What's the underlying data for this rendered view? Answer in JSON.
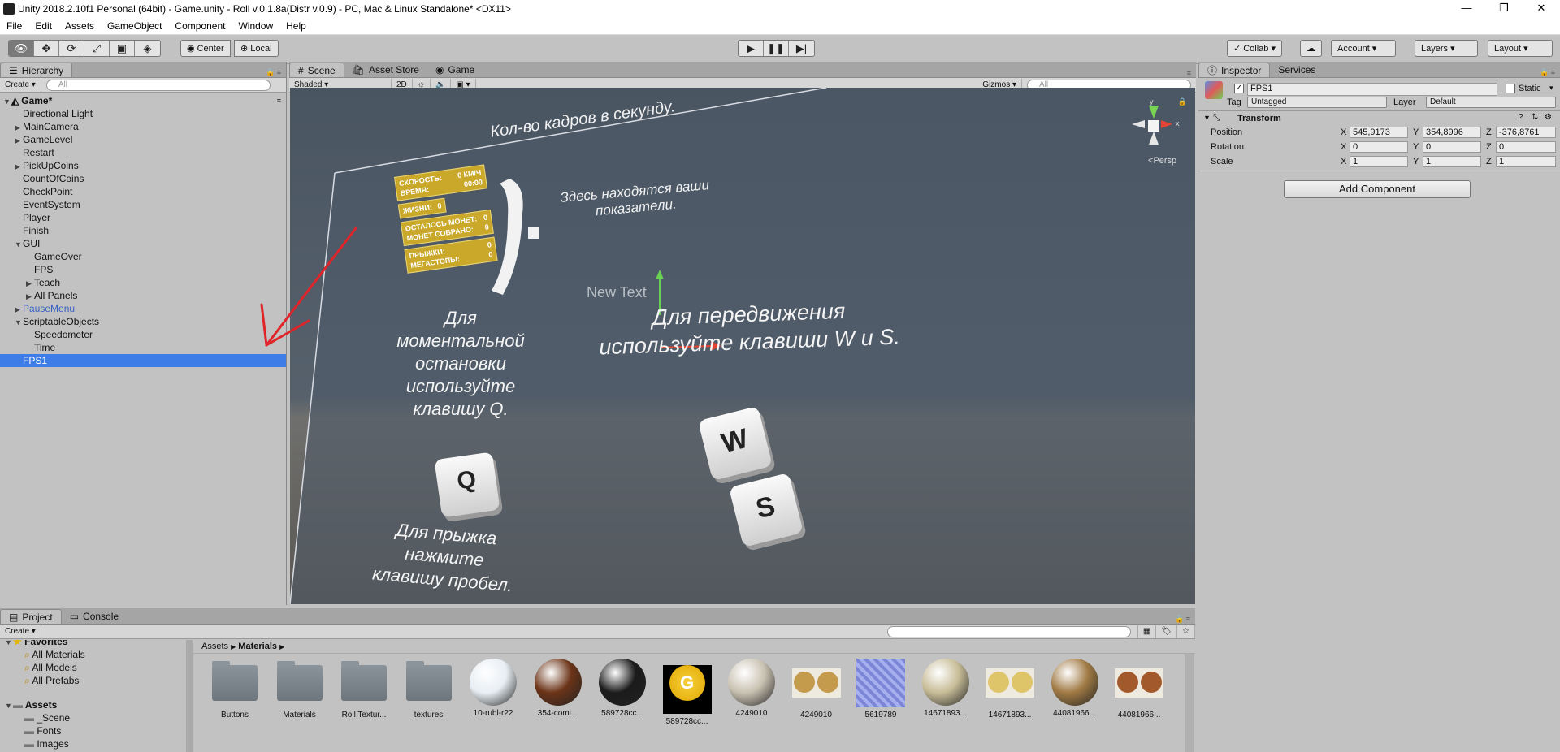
{
  "window": {
    "title": "Unity 2018.2.10f1 Personal (64bit) - Game.unity - Roll v.0.1.8a(Distr v.0.9) - PC, Mac & Linux Standalone* <DX11>",
    "minimize": "—",
    "maximize": "❐",
    "close": "✕"
  },
  "menu": [
    "File",
    "Edit",
    "Assets",
    "GameObject",
    "Component",
    "Window",
    "Help"
  ],
  "toolbar": {
    "tools": [
      "eye-icon",
      "move-icon",
      "rotate-icon",
      "scale-icon",
      "rect-icon",
      "transform-icon"
    ],
    "pivot": "Center",
    "space": "Local",
    "collab": "Collab ▾",
    "account": "Account ▾",
    "layers": "Layers ▾",
    "layout": "Layout ▾"
  },
  "hierarchy": {
    "tab": "Hierarchy",
    "create": "Create ▾",
    "search_placeholder": "All",
    "scene": "Game*",
    "items": [
      {
        "label": "Directional Light",
        "depth": 1,
        "arrow": ""
      },
      {
        "label": "MainCamera",
        "depth": 1,
        "arrow": "▶"
      },
      {
        "label": "GameLevel",
        "depth": 1,
        "arrow": "▶"
      },
      {
        "label": "Restart",
        "depth": 1,
        "arrow": ""
      },
      {
        "label": "PickUpCoins",
        "depth": 1,
        "arrow": "▶"
      },
      {
        "label": "CountOfCoins",
        "depth": 1,
        "arrow": ""
      },
      {
        "label": "CheckPoint",
        "depth": 1,
        "arrow": ""
      },
      {
        "label": "EventSystem",
        "depth": 1,
        "arrow": ""
      },
      {
        "label": "Player",
        "depth": 1,
        "arrow": ""
      },
      {
        "label": "Finish",
        "depth": 1,
        "arrow": ""
      },
      {
        "label": "GUI",
        "depth": 1,
        "arrow": "▼"
      },
      {
        "label": "GameOver",
        "depth": 2,
        "arrow": ""
      },
      {
        "label": "FPS",
        "depth": 2,
        "arrow": ""
      },
      {
        "label": "Teach",
        "depth": 2,
        "arrow": "▶"
      },
      {
        "label": "All Panels",
        "depth": 2,
        "arrow": "▶"
      },
      {
        "label": "PauseMenu",
        "depth": 1,
        "arrow": "▶",
        "prefab": true
      },
      {
        "label": "ScriptableObjects",
        "depth": 1,
        "arrow": "▼"
      },
      {
        "label": "Speedometer",
        "depth": 2,
        "arrow": ""
      },
      {
        "label": "Time",
        "depth": 2,
        "arrow": ""
      },
      {
        "label": "FPS1",
        "depth": 1,
        "arrow": "",
        "selected": true
      }
    ]
  },
  "sceneview": {
    "tabs": [
      "Scene",
      "Asset Store",
      "Game"
    ],
    "shading": "Shaded ▾",
    "mode2d": "2D",
    "gizmos": "Gizmos ▾",
    "search_placeholder": "All",
    "persp": "Persp",
    "texts": {
      "fps_header": "Кол-во кадров в секунду.",
      "hud_desc": "Здесь находятся ваши показатели.",
      "move": "Для передвижения используйте клавиши W и S.",
      "stop": "Для моментальной остановки используйте клавишу Q.",
      "jump": "Для прыжка нажмите клавишу пробел.",
      "new_text": "New Text",
      "key_w": "W",
      "key_s": "S",
      "key_q": "Q"
    },
    "hud": [
      {
        "l": "СКОРОСТЬ:",
        "v": "0 КМ/Ч"
      },
      {
        "l": "ВРЕМЯ:",
        "v": "00:00"
      },
      {
        "l": "ЖИЗНИ:",
        "v": "0"
      },
      {
        "l": "ОСТАЛОСЬ МОНЕТ:",
        "v": "0"
      },
      {
        "l": "МОНЕТ СОБРАНО:",
        "v": "0"
      },
      {
        "l": "ПРЫЖКИ:",
        "v": "0"
      },
      {
        "l": "МЕГАСТОПЫ:",
        "v": "0"
      }
    ]
  },
  "inspector": {
    "tabs": [
      "Inspector",
      "Services"
    ],
    "name": "FPS1",
    "static": "Static",
    "tag_label": "Tag",
    "tag": "Untagged",
    "layer_label": "Layer",
    "layer": "Default",
    "component": "Transform",
    "position_label": "Position",
    "rotation_label": "Rotation",
    "scale_label": "Scale",
    "position": {
      "x": "545,9173",
      "y": "354,8996",
      "z": "-376,8761"
    },
    "rotation": {
      "x": "0",
      "y": "0",
      "z": "0"
    },
    "scale": {
      "x": "1",
      "y": "1",
      "z": "1"
    },
    "axis": {
      "x": "X",
      "y": "Y",
      "z": "Z"
    },
    "add_component": "Add Component"
  },
  "project": {
    "tabs": [
      "Project",
      "Console"
    ],
    "create": "Create ▾",
    "favorites_label": "Favorites",
    "favorites": [
      "All Materials",
      "All Models",
      "All Prefabs"
    ],
    "assets_label": "Assets",
    "asset_folders": [
      "_Scene",
      "Fonts",
      "Images"
    ],
    "breadcrumb": [
      "Assets",
      "Materials"
    ],
    "items": [
      {
        "name": "Buttons",
        "kind": "folder"
      },
      {
        "name": "Materials",
        "kind": "folder"
      },
      {
        "name": "Roll Textur...",
        "kind": "folder"
      },
      {
        "name": "textures",
        "kind": "folder"
      },
      {
        "name": "10-rubl-r22",
        "kind": "sphere",
        "color": "#e8eef3"
      },
      {
        "name": "354-comi...",
        "kind": "sphere",
        "color": "#6b3418"
      },
      {
        "name": "589728cc...",
        "kind": "sphere",
        "color": "#1b1b1b"
      },
      {
        "name": "589728cc...",
        "kind": "coin",
        "color": "#e0a800"
      },
      {
        "name": "4249010",
        "kind": "sphere",
        "color": "#c9c2b2"
      },
      {
        "name": "4249010",
        "kind": "coins",
        "color": "#c49a4c"
      },
      {
        "name": "5619789",
        "kind": "tile",
        "color": "#7c86d6"
      },
      {
        "name": "14671893...",
        "kind": "sphere",
        "color": "#c8bd98"
      },
      {
        "name": "14671893...",
        "kind": "coins",
        "color": "#dfc56a"
      },
      {
        "name": "44081966...",
        "kind": "sphere",
        "color": "#a07a44"
      },
      {
        "name": "44081966...",
        "kind": "coins",
        "color": "#a25a2c"
      }
    ]
  }
}
